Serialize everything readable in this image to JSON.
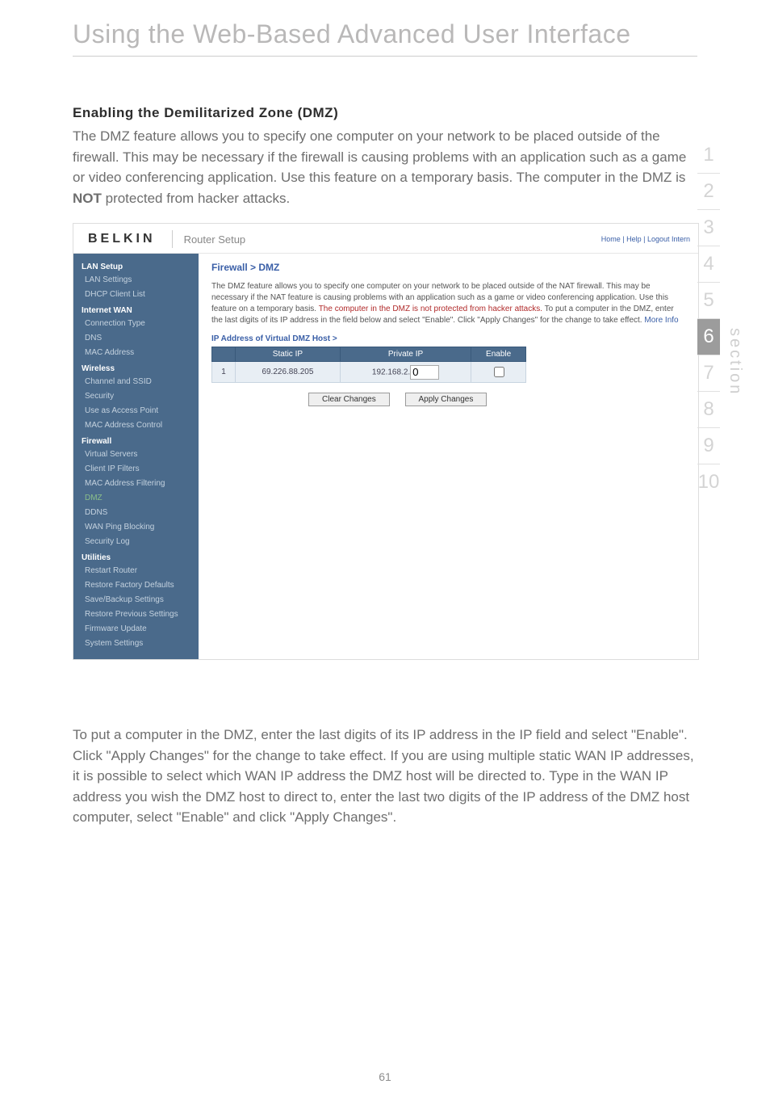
{
  "page": {
    "heading": "Using the Web-Based Advanced User Interface",
    "number": "61"
  },
  "dmz_section": {
    "title": "Enabling the Demilitarized Zone (DMZ)",
    "intro_pre_not": "The DMZ feature allows you to specify one computer on your network to be placed outside of the firewall. This may be necessary if the firewall is causing problems with an application such as a game or video conferencing application. Use this feature on a temporary basis. The computer in the DMZ is ",
    "not": "NOT",
    "intro_post_not": " protected from hacker attacks.",
    "outro": "To put a computer in the DMZ, enter the last digits of its IP address in the IP field and select \"Enable\". Click \"Apply Changes\" for the change to take effect. If you are using multiple static WAN IP addresses, it is possible to select which WAN IP address the DMZ host will be directed to. Type in the WAN IP address you wish the DMZ host to direct to, enter the last two digits of the IP address of the DMZ host computer, select \"Enable\" and click \"Apply Changes\"."
  },
  "tabs": {
    "items": [
      "1",
      "2",
      "3",
      "4",
      "5",
      "6",
      "7",
      "8",
      "9",
      "10"
    ],
    "active_index": 5,
    "label": "section"
  },
  "router": {
    "brand": "BELKIN",
    "title": "Router Setup",
    "top_links": "Home | Help | Logout   Intern",
    "nav": {
      "groups": [
        {
          "label": "LAN Setup",
          "items": [
            {
              "label": "LAN Settings"
            },
            {
              "label": "DHCP Client List"
            }
          ]
        },
        {
          "label": "Internet WAN",
          "items": [
            {
              "label": "Connection Type"
            },
            {
              "label": "DNS"
            },
            {
              "label": "MAC Address"
            }
          ]
        },
        {
          "label": "Wireless",
          "items": [
            {
              "label": "Channel and SSID"
            },
            {
              "label": "Security"
            },
            {
              "label": "Use as Access Point"
            },
            {
              "label": "MAC Address Control"
            }
          ]
        },
        {
          "label": "Firewall",
          "items": [
            {
              "label": "Virtual Servers"
            },
            {
              "label": "Client IP Filters"
            },
            {
              "label": "MAC Address Filtering"
            },
            {
              "label": "DMZ",
              "active": true
            },
            {
              "label": "DDNS"
            },
            {
              "label": "WAN Ping Blocking"
            },
            {
              "label": "Security Log"
            }
          ]
        },
        {
          "label": "Utilities",
          "items": [
            {
              "label": "Restart Router"
            },
            {
              "label": "Restore Factory Defaults"
            },
            {
              "label": "Save/Backup Settings"
            },
            {
              "label": "Restore Previous Settings"
            },
            {
              "label": "Firmware Update"
            },
            {
              "label": "System Settings"
            }
          ]
        }
      ]
    },
    "content": {
      "breadcrumb": "Firewall > DMZ",
      "desc_main": "The DMZ feature allows you to specify one computer on your network to be placed outside of the NAT firewall. This may be necessary if the NAT feature is causing problems with an application such as a game or video conferencing application. Use this feature on a temporary basis.",
      "desc_warn": "The computer in the DMZ is not protected from hacker attacks.",
      "desc_after": "To put a computer in the DMZ, enter the last digits of its IP address in the field below and select \"Enable\". Click \"Apply Changes\" for the change to take effect.",
      "more_info": "More Info",
      "ip_label": "IP Address of Virtual DMZ Host >",
      "table": {
        "headers": [
          "",
          "Static IP",
          "Private IP",
          "Enable"
        ],
        "row": {
          "idx": "1",
          "static_ip": "69.226.88.205",
          "private_prefix": "192.168.2.",
          "private_value": "0"
        }
      },
      "buttons": {
        "clear": "Clear Changes",
        "apply": "Apply Changes"
      }
    }
  }
}
